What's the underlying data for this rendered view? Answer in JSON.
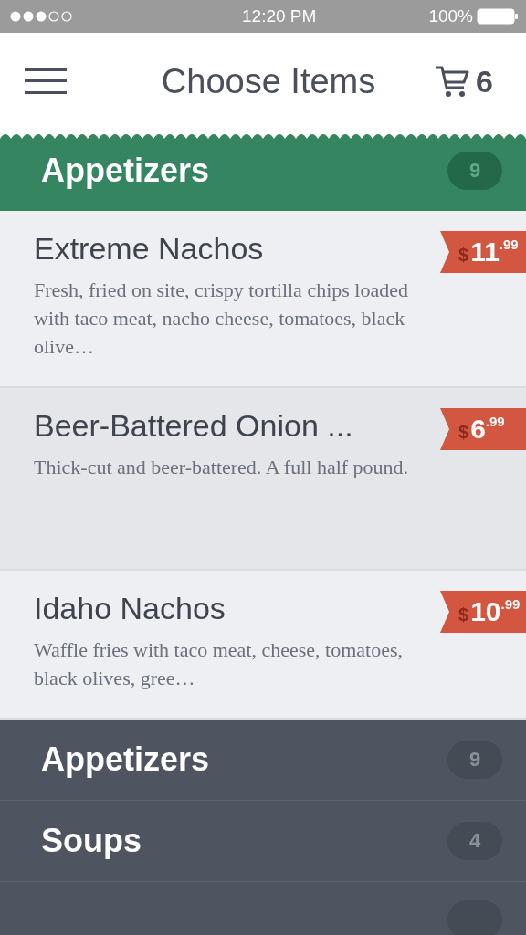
{
  "status_bar": {
    "time": "12:20 PM",
    "battery": "100%"
  },
  "header": {
    "title": "Choose Items",
    "cart_count": "6"
  },
  "current_category": {
    "name": "Appetizers",
    "count": "9"
  },
  "items": [
    {
      "name": "Extreme Nachos",
      "description": "Fresh, fried on site, crispy tortilla chips loaded with taco meat, nacho cheese, tomatoes, black olive…",
      "price": {
        "currency": "$",
        "dollars": "11",
        "cents": ".99"
      },
      "selected": false
    },
    {
      "name": "Beer-Battered Onion ...",
      "description": "Thick-cut and beer-battered. A full half pound.",
      "price": {
        "currency": "$",
        "dollars": "6",
        "cents": ".99"
      },
      "selected": true
    },
    {
      "name": "Idaho Nachos",
      "description": "Waffle fries with taco meat, cheese, tomatoes, black olives, gree…",
      "price": {
        "currency": "$",
        "dollars": "10",
        "cents": ".99"
      },
      "selected": false
    }
  ],
  "categories": [
    {
      "name": "Appetizers",
      "count": "9"
    },
    {
      "name": "Soups",
      "count": "4"
    }
  ]
}
